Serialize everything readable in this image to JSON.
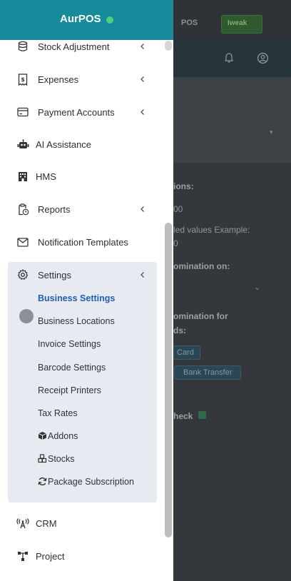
{
  "brand": {
    "name": "AurPOS"
  },
  "background": {
    "pos_label": "POS",
    "green_button": "Iweak",
    "texts": [
      "ions:",
      "00",
      "led values Example:",
      "0",
      "omination on:",
      "omination for",
      "ds:",
      "heck"
    ],
    "chips": [
      "Card",
      "Bank Transfer"
    ]
  },
  "sidebar": {
    "items": [
      {
        "label": "Stock Adjustment",
        "icon": "database-icon",
        "chevron": true
      },
      {
        "label": "Expenses",
        "icon": "receipt-dollar-icon",
        "chevron": true
      },
      {
        "label": "Payment Accounts",
        "icon": "credit-card-icon",
        "chevron": true
      },
      {
        "label": "AI Assistance",
        "icon": "robot-icon",
        "chevron": false
      },
      {
        "label": "HMS",
        "icon": "hotel-icon",
        "chevron": false
      },
      {
        "label": "Reports",
        "icon": "report-clock-icon",
        "chevron": true
      },
      {
        "label": "Notification Templates",
        "icon": "envelope-icon",
        "chevron": false
      },
      {
        "label": "Settings",
        "icon": "gear-icon",
        "chevron": true
      }
    ],
    "settings_sub": [
      {
        "label": "Business Settings",
        "active": true
      },
      {
        "label": "Business Locations",
        "active": false
      },
      {
        "label": "Invoice Settings",
        "active": false
      },
      {
        "label": "Barcode Settings",
        "active": false
      },
      {
        "label": "Receipt Printers",
        "active": false
      },
      {
        "label": "Tax Rates",
        "active": false
      },
      {
        "label": "Addons",
        "icon": "cube-icon",
        "active": false
      },
      {
        "label": "Stocks",
        "icon": "cubes-icon",
        "active": false
      },
      {
        "label": "Package Subscription",
        "icon": "sync-icon",
        "active": false
      }
    ],
    "bottom_items": [
      {
        "label": "CRM",
        "icon": "broadcast-icon"
      },
      {
        "label": "Project",
        "icon": "project-tree-icon"
      }
    ]
  }
}
